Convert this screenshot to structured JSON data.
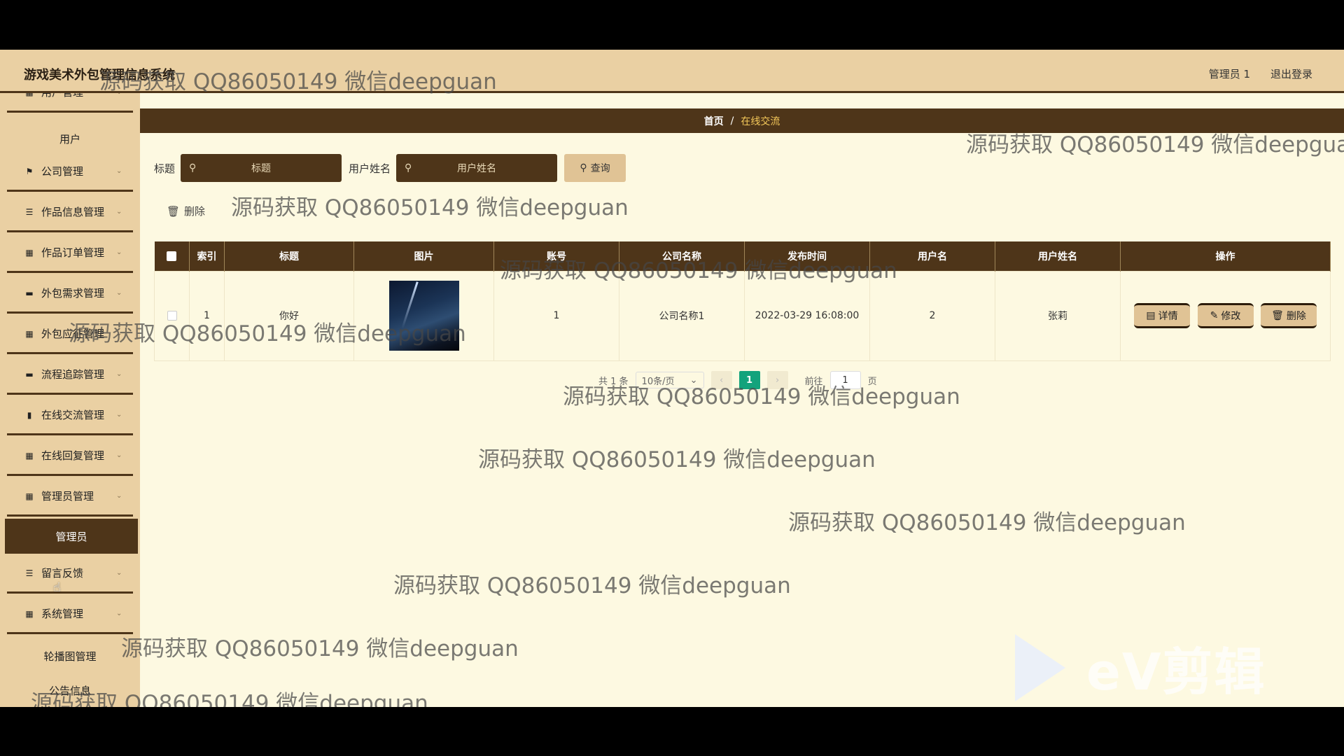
{
  "app": {
    "title": "游戏美术外包管理信息系统",
    "admin_name": "管理员 1",
    "logout": "退出登录"
  },
  "sidebar": {
    "items": [
      {
        "label": "用户管理",
        "icon": "grid-icon"
      },
      {
        "label": "用户",
        "sub": true
      },
      {
        "label": "公司管理",
        "icon": "flag-icon"
      },
      {
        "label": "作品信息管理",
        "icon": "list-icon"
      },
      {
        "label": "作品订单管理",
        "icon": "grid-icon"
      },
      {
        "label": "外包需求管理",
        "icon": "monitor-icon"
      },
      {
        "label": "外包应征管理",
        "icon": "grid-icon"
      },
      {
        "label": "流程追踪管理",
        "icon": "monitor-icon"
      },
      {
        "label": "在线交流管理",
        "icon": "bar-chart-icon"
      },
      {
        "label": "在线回复管理",
        "icon": "grid-icon"
      },
      {
        "label": "管理员管理",
        "icon": "grid-icon"
      },
      {
        "label": "管理员",
        "sub": true,
        "active": true
      },
      {
        "label": "留言反馈",
        "icon": "list-icon"
      },
      {
        "label": "系统管理",
        "icon": "grid-icon"
      },
      {
        "label": "轮播图管理",
        "sub": true
      },
      {
        "label": "公告信息",
        "sub": true
      }
    ]
  },
  "breadcrumb": {
    "home": "首页",
    "separator": "/",
    "current": "在线交流"
  },
  "search": {
    "title_label": "标题",
    "title_placeholder": "标题",
    "username_label": "用户姓名",
    "username_placeholder": "用户姓名",
    "query_button": "查询"
  },
  "toolbar": {
    "delete_label": "删除"
  },
  "table": {
    "columns": [
      "索引",
      "标题",
      "图片",
      "账号",
      "公司名称",
      "发布时间",
      "用户名",
      "用户姓名",
      "操作"
    ],
    "rows": [
      {
        "index": "1",
        "title": "你好",
        "account": "1",
        "company": "公司名称1",
        "publish_time": "2022-03-29 16:08:00",
        "user_name": "2",
        "real_name": "张莉"
      }
    ],
    "actions": {
      "detail": "详情",
      "edit": "修改",
      "delete": "删除"
    }
  },
  "pagination": {
    "total": "共 1 条",
    "page_size": "10条/页",
    "current_page": "1",
    "goto_label": "前往",
    "goto_value": "1",
    "page_unit": "页"
  },
  "watermark": {
    "text": "源码获取 QQ86050149 微信deepguan",
    "logo_text": "eV剪辑"
  }
}
